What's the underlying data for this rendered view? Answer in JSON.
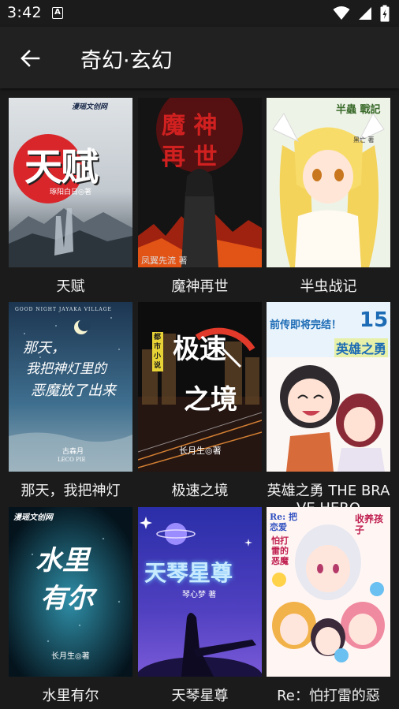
{
  "status": {
    "time": "3:42",
    "notification_letter": "A"
  },
  "header": {
    "title": "奇幻·玄幻"
  },
  "books": [
    {
      "title": "天赋",
      "cover_main": "天赋",
      "cover_publisher": "漫瑶文创网",
      "cover_author": "琢阳白日◎著"
    },
    {
      "title": "魔神再世",
      "cover_main_1": "魔 神",
      "cover_main_2": "再 世",
      "cover_author": "凤翼先流 著"
    },
    {
      "title": "半虫战记",
      "cover_main": "半蟲 戰記",
      "cover_author": "黑亡 著"
    },
    {
      "title": "那天，我把神灯",
      "cover_top": "GOOD NIGHT JAYAKA VILLAGE",
      "cover_line1": "那天，",
      "cover_line2": "我把神灯里的",
      "cover_line3": "恶魔放了出来",
      "cover_author": "古森月",
      "cover_bottom": "LECO PIE"
    },
    {
      "title": "极速之境",
      "cover_main_1": "极速",
      "cover_main_2": "之境",
      "cover_badge": "都市小说",
      "cover_author": "长月生◎著"
    },
    {
      "title": "英雄之勇 THE BRAVE HERO",
      "cover_banner": "前传即将完结！",
      "cover_number": "15",
      "cover_main": "英雄之勇"
    },
    {
      "title": "水里有尔",
      "cover_publisher": "漫瑶文创网",
      "cover_main_1": "水里",
      "cover_main_2": "有尔",
      "cover_author": "长月生◎著"
    },
    {
      "title": "天琴星尊",
      "cover_main": "天琴星尊",
      "cover_author": "琴心梦 著"
    },
    {
      "title": "Re：怕打雷的惡",
      "cover_line1": "Re: 把恋爱",
      "cover_line2": "怕打雷的恶魔",
      "cover_line3": "收养孩子"
    }
  ],
  "colors": {
    "background": "#1b1b1b",
    "app_bar": "#212121",
    "text": "#ffffff"
  }
}
